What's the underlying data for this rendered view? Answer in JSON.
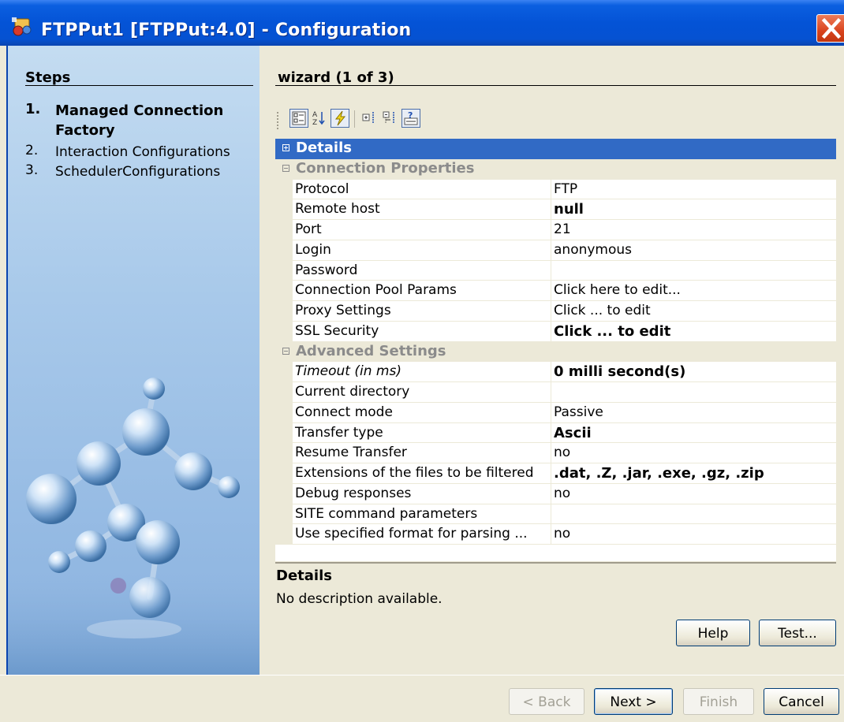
{
  "window": {
    "title": "FTPPut1 [FTPPut:4.0] - Configuration"
  },
  "steps": {
    "header": "Steps",
    "items": [
      {
        "num": "1.",
        "label": "Managed Connection Factory",
        "active": true
      },
      {
        "num": "2.",
        "label": "Interaction Configurations",
        "active": false
      },
      {
        "num": "3.",
        "label": "SchedulerConfigurations",
        "active": false
      }
    ]
  },
  "wizard": {
    "title": "wizard (1 of 3)"
  },
  "toolbar": {
    "buttons": [
      "categorized-view-icon",
      "sort-alphabetical-icon",
      "lightning-icon",
      "expand-all-icon",
      "collapse-all-icon",
      "help-info-icon"
    ]
  },
  "properties": {
    "details_label": "Details",
    "section1": "Connection Properties",
    "section2": "Advanced Settings",
    "rows": [
      {
        "name": "Protocol",
        "value": "FTP"
      },
      {
        "name": "Remote host",
        "value": "null"
      },
      {
        "name": "Port",
        "value": "21"
      },
      {
        "name": "Login",
        "value": "anonymous"
      },
      {
        "name": "Password",
        "value": ""
      },
      {
        "name": "Connection Pool Params",
        "value": "Click here to edit..."
      },
      {
        "name": "Proxy Settings",
        "value": "Click ... to edit"
      },
      {
        "name": "SSL Security",
        "value": "Click ... to edit"
      },
      {
        "name": "Timeout (in ms)",
        "value": "0 milli second(s)"
      },
      {
        "name": "Current directory",
        "value": ""
      },
      {
        "name": "Connect mode",
        "value": "Passive"
      },
      {
        "name": "Transfer type",
        "value": "Ascii"
      },
      {
        "name": "Resume Transfer",
        "value": "no"
      },
      {
        "name": "Extensions of the files to be filtered",
        "value": ".dat, .Z, .jar, .exe, .gz, .zip"
      },
      {
        "name": "Debug responses",
        "value": "no"
      },
      {
        "name": "SITE command parameters",
        "value": ""
      },
      {
        "name": "Use specified format for parsing ...",
        "value": "no"
      }
    ]
  },
  "details": {
    "title": "Details",
    "description": "No description available."
  },
  "buttons": {
    "help": "Help",
    "test": "Test...",
    "back": "< Back",
    "next": "Next >",
    "finish": "Finish",
    "cancel": "Cancel"
  },
  "colors": {
    "titlebar": "#0453d6",
    "selection": "#316ac5",
    "close": "#d9441e"
  }
}
